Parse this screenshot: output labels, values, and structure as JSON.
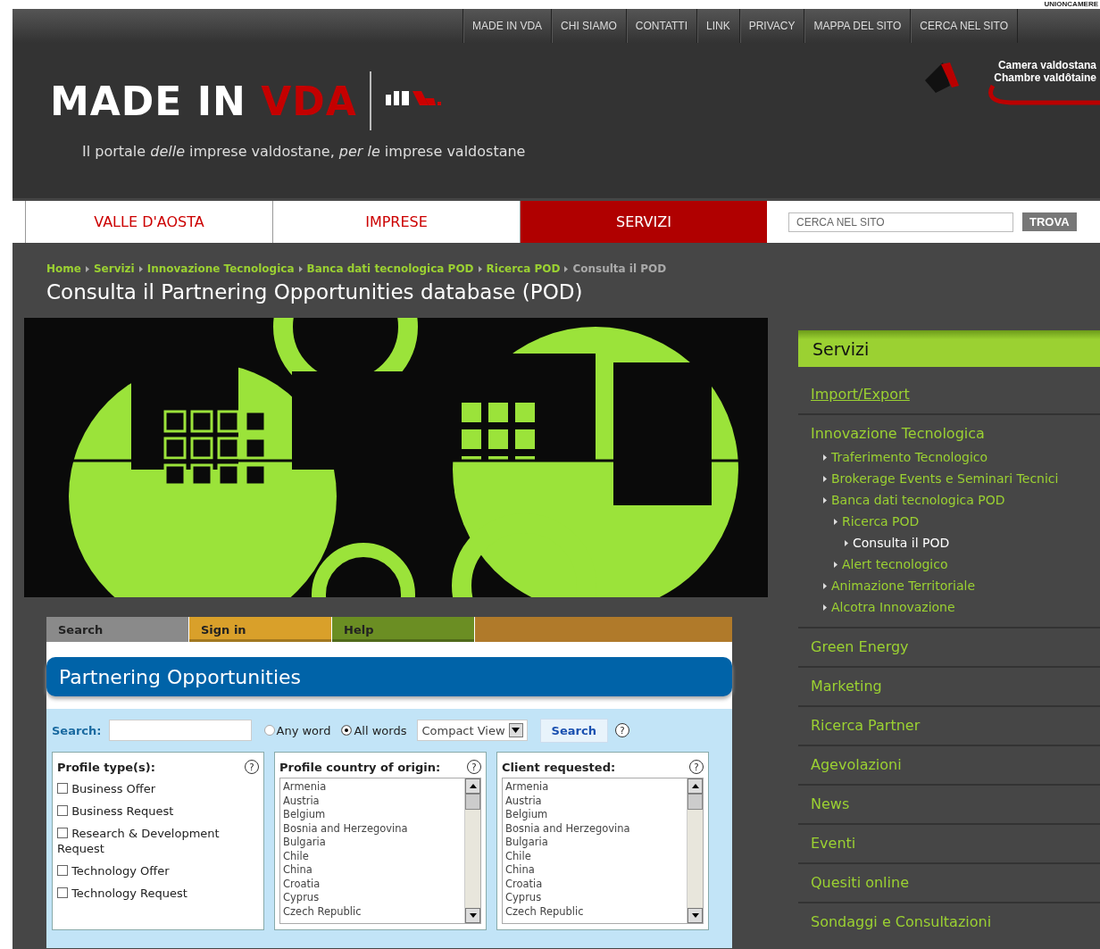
{
  "corner_label": "UNIONCAMERE",
  "top_links": [
    "MADE IN VDA",
    "CHI SIAMO",
    "CONTATTI",
    "LINK",
    "PRIVACY",
    "MAPPA DEL SITO",
    "CERCA NEL SITO"
  ],
  "header": {
    "logo_main": "MADE IN",
    "logo_accent": "VDA",
    "tagline": "Il portale *delle* imprese valdostane, *per le* imprese valdostane",
    "partner_lines": [
      "Camera valdostana",
      "Chambre valdôtaine"
    ]
  },
  "main_nav": [
    {
      "label": "VALLE D'AOSTA",
      "selected": false
    },
    {
      "label": "IMPRESE",
      "selected": false
    },
    {
      "label": "SERVIZI",
      "selected": true
    }
  ],
  "site_search": {
    "placeholder": "CERCA NEL SITO",
    "button": "TROVA"
  },
  "breadcrumbs": [
    "Home",
    "Servizi",
    "Innovazione Tecnologica",
    "Banca dati tecnologica POD",
    "Ricerca POD",
    "Consulta il POD"
  ],
  "page_title": "Consulta il Partnering Opportunities database (POD)",
  "pod": {
    "tabs": [
      {
        "label": "Search",
        "selected": true,
        "color": "#8a8a8a"
      },
      {
        "label": "Sign in",
        "selected": false,
        "color": "#d9a02a"
      },
      {
        "label": "Help",
        "selected": false,
        "color": "#6b8e23"
      }
    ],
    "title": "Partnering Opportunities",
    "search_label": "Search:",
    "match_options": [
      {
        "label": "Any word",
        "selected": false
      },
      {
        "label": "All words",
        "selected": true
      }
    ],
    "view_select": "Compact View",
    "search_button": "Search",
    "help_mark": "?",
    "panels": [
      {
        "kind": "checkboxes",
        "title": "Profile type(s):",
        "options": [
          {
            "label": "Business Offer",
            "checked": false
          },
          {
            "label": "Business Request",
            "checked": false
          },
          {
            "label": "Research & Development Request",
            "checked": false
          },
          {
            "label": "Technology Offer",
            "checked": false
          },
          {
            "label": "Technology Request",
            "checked": false
          }
        ]
      },
      {
        "kind": "list",
        "title": "Profile country of origin:",
        "options": [
          "Armenia",
          "Austria",
          "Belgium",
          "Bosnia and Herzegovina",
          "Bulgaria",
          "Chile",
          "China",
          "Croatia",
          "Cyprus",
          "Czech Republic"
        ]
      },
      {
        "kind": "list",
        "title": "Client requested:",
        "options": [
          "Armenia",
          "Austria",
          "Belgium",
          "Bosnia and Herzegovina",
          "Bulgaria",
          "Chile",
          "China",
          "Croatia",
          "Cyprus",
          "Czech Republic"
        ]
      }
    ]
  },
  "sidebar": {
    "title": "Servizi",
    "items": [
      {
        "label": "Import/Export",
        "selected": false
      },
      {
        "label": "Innovazione Tecnologica",
        "selected": false,
        "children": [
          {
            "label": "Traferimento Tecnologico",
            "selected": false
          },
          {
            "label": "Brokerage Events e Seminari Tecnici",
            "selected": false
          },
          {
            "label": "Banca dati tecnologica POD",
            "selected": false,
            "children": [
              {
                "label": "Ricerca POD",
                "selected": false,
                "children": [
                  {
                    "label": "Consulta il POD",
                    "selected": true
                  }
                ]
              },
              {
                "label": "Alert tecnologico",
                "selected": false
              }
            ]
          },
          {
            "label": "Animazione Territoriale",
            "selected": false
          },
          {
            "label": "Alcotra Innovazione",
            "selected": false
          }
        ]
      },
      {
        "label": "Green Energy",
        "selected": false
      },
      {
        "label": "Marketing",
        "selected": false
      },
      {
        "label": "Ricerca Partner",
        "selected": false
      },
      {
        "label": "Agevolazioni",
        "selected": false
      },
      {
        "label": "News",
        "selected": false
      },
      {
        "label": "Eventi",
        "selected": false
      },
      {
        "label": "Quesiti online",
        "selected": false
      },
      {
        "label": "Sondaggi e Consultazioni",
        "selected": false
      }
    ]
  }
}
